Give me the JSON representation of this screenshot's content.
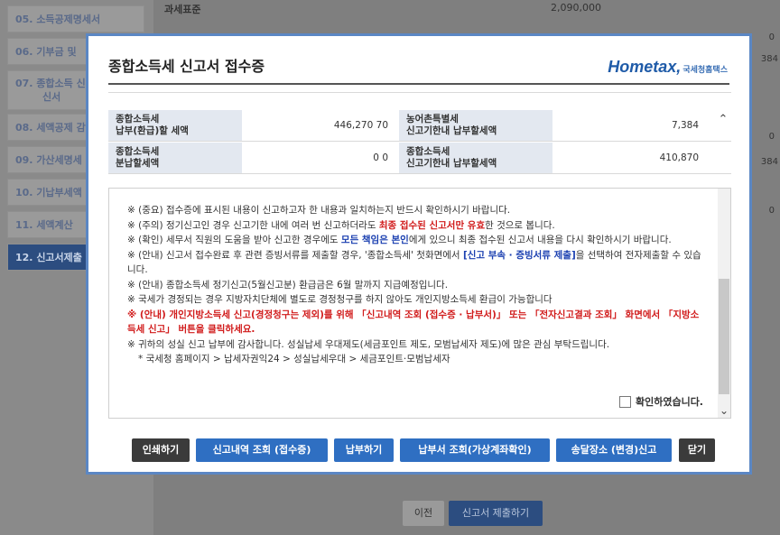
{
  "sidebar": {
    "items": [
      {
        "label": "05. 소득공제명세서"
      },
      {
        "label": "06. 기부금 및"
      },
      {
        "label": "07. 종합소득 신"
      },
      {
        "label": "신서"
      },
      {
        "label": "08. 세액공제 감"
      },
      {
        "label": "09. 가산세명세"
      },
      {
        "label": "10. 기납부세액"
      },
      {
        "label": "11. 세액계산"
      },
      {
        "label": "12. 신고서제출"
      }
    ]
  },
  "background": {
    "row1_label": "과세표준",
    "row1_value": "2,090,000",
    "edge_values": [
      "0",
      "384",
      "0",
      "384",
      "0"
    ],
    "prev_button": "이전",
    "submit_button": "신고서 제출하기"
  },
  "modal": {
    "title": "종합소득세 신고서 접수증",
    "logo_text": "Hometax,",
    "logo_sub": "국세청홈택스",
    "summary": {
      "r1_left_label": "종합소득세\n납부(환급)할 세액",
      "r1_left_value": "446,270 70",
      "r1_right_label": "농어촌특별세\n신고기한내 납부할세액",
      "r1_right_value": "7,384",
      "r2_left_label": "종합소득세\n분납할세액",
      "r2_left_value": "0 0",
      "r2_right_label": "종합소득세\n신고기한내 납부할세액",
      "r2_right_value": "410,870"
    },
    "notice": {
      "l1": "※ (중요) 접수증에 표시된 내용이 신고하고자 한 내용과 일치하는지 반드시 확인하시기 바랍니다.",
      "l2a": "※ (주의) 정기신고인 경우 신고기한 내에 여러 번 신고하더라도 ",
      "l2b": "최종 접수된 신고서만 유효",
      "l2c": "한 것으로 봅니다.",
      "l3a": "※ (확인) 세무서 직원의 도움을 받아 신고한 경우에도 ",
      "l3b": "모든 책임은 본인",
      "l3c": "에게 있으니 최종 접수된 신고서 내용을 다시 확인하시기 바랍니다.",
      "l4a": "※ (안내) 신고서 접수완료 후 관련 증빙서류를 제출할 경우, '종합소득세' 첫화면에서 ",
      "l4b": "[신고 부속 · 증빙서류 제출]",
      "l4c": "을 선택하여 전자제출할 수 있습니다.",
      "l5": "※ (안내) 종합소득세 정기신고(5월신고분) 환급금은 6월 말까지 지급예정입니다.",
      "l6": "※ 국세가 경정되는 경우 지방자치단체에 별도로 경정청구를 하지 않아도 개인지방소득세 환급이 가능합니다",
      "l7": "※ (안내) 개인지방소득세 신고(경정청구는 제외)를 위해 「신고내역 조회 (접수증 · 납부서)」 또는 「전자신고결과 조회」 화면에서 「지방소득세 신고」 버튼을 클릭하세요.",
      "l8": "※ 귀하의 성실 신고 납부에 감사합니다. 성실납세 우대제도(세금포인트 제도, 모범납세자 제도)에 많은 관심 부탁드립니다.",
      "l9": "* 국세청 홈페이지 > 납세자권익24 > 성실납세우대 > 세금포인트·모범납세자",
      "confirm_label": "확인하였습니다."
    },
    "buttons": {
      "print": "인쇄하기",
      "history": "신고내역 조회 (접수증)",
      "pay": "납부하기",
      "payslip": "납부서 조회(가상계좌확인)",
      "delivery": "송달장소 (변경)신고",
      "close": "닫기"
    }
  }
}
